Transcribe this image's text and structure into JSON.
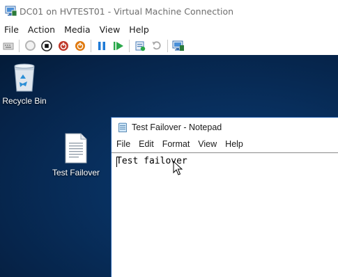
{
  "window": {
    "title": "DC01 on HVTEST01 - Virtual Machine Connection"
  },
  "menu": [
    "File",
    "Action",
    "Media",
    "View",
    "Help"
  ],
  "toolbar": {
    "buttons": [
      {
        "name": "ctrl-alt-del-icon"
      },
      {
        "name": "start-icon"
      },
      {
        "name": "turn-off-icon"
      },
      {
        "name": "shut-down-icon"
      },
      {
        "name": "save-icon"
      },
      {
        "name": "pause-icon"
      },
      {
        "name": "resume-icon"
      },
      {
        "name": "checkpoint-icon"
      },
      {
        "name": "revert-icon"
      },
      {
        "name": "enhanced-session-icon"
      }
    ]
  },
  "desktop": {
    "icons": [
      {
        "label": "Recycle Bin",
        "icon": "recycle-bin-icon"
      },
      {
        "label": "Test Failover",
        "icon": "text-document-icon"
      }
    ]
  },
  "notepad": {
    "title": "Test Failover - Notepad",
    "menu": [
      "File",
      "Edit",
      "Format",
      "View",
      "Help"
    ],
    "content": "Test failover"
  },
  "colors": {
    "desktop_bg": "#08305f",
    "stop_red": "#c0392b",
    "power_orange": "#e07a10",
    "play_green": "#2aa84a",
    "pause_blue": "#1e7ad6"
  }
}
